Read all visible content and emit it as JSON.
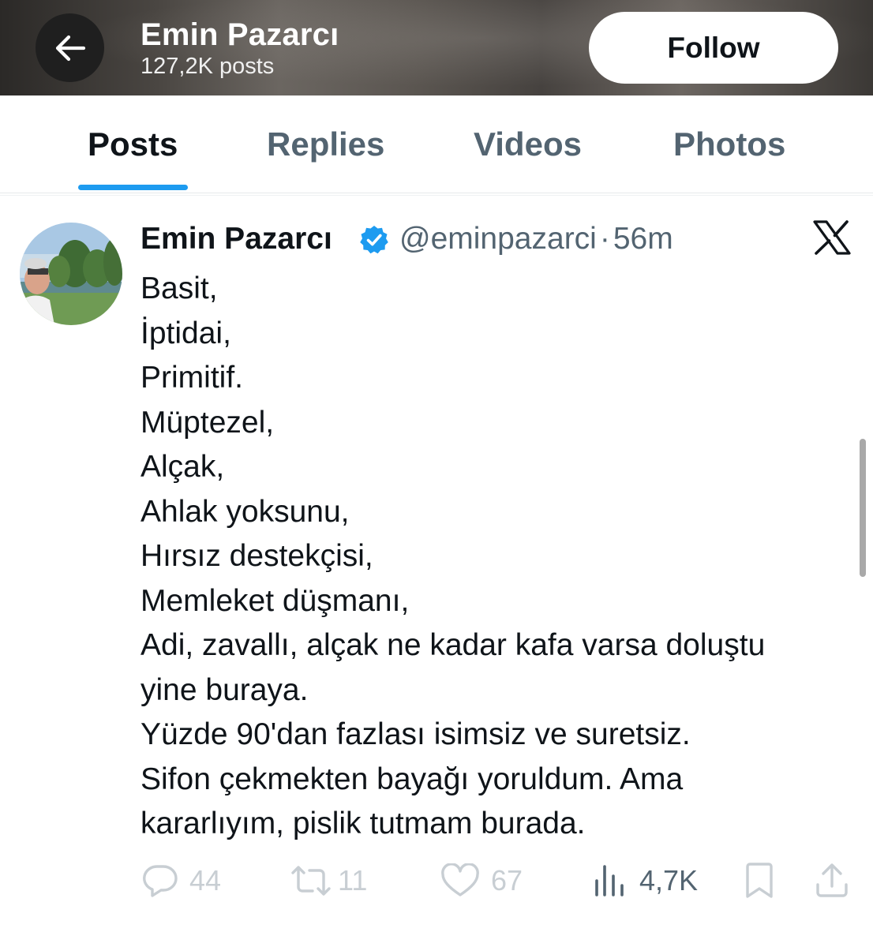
{
  "header": {
    "title": "Emin Pazarcı",
    "subtitle": "127,2K posts",
    "follow_label": "Follow"
  },
  "tabs": [
    {
      "label": "Posts",
      "active": true
    },
    {
      "label": "Replies",
      "active": false
    },
    {
      "label": "Videos",
      "active": false
    },
    {
      "label": "Photos",
      "active": false
    }
  ],
  "post": {
    "author_name": "Emin Pazarcı",
    "handle": "@eminpazarci",
    "separator": "·",
    "time": "56m",
    "verified": true,
    "lines": [
      "Basit,",
      "İptidai,",
      "Primitif.",
      "Müptezel,",
      "Alçak,",
      "Ahlak yoksunu,",
      "Hırsız destekçisi,",
      "Memleket düşmanı,",
      "Adi, zavallı, alçak ne kadar kafa varsa doluştu",
      "yine buraya.",
      "Yüzde 90'dan fazlası isimsiz ve suretsiz.",
      "Sifon çekmekten bayağı yoruldum. Ama",
      "kararlıyım, pislik tutmam burada."
    ],
    "stats": {
      "replies": "44",
      "reposts": "11",
      "likes": "67",
      "views": "4,7K"
    }
  },
  "icons": {
    "back": "arrow-left-icon",
    "verified": "verified-badge-icon",
    "platform": "x-logo-icon",
    "reply": "comment-icon",
    "repost": "repost-icon",
    "like": "heart-icon",
    "views": "views-chart-icon",
    "bookmark": "bookmark-icon",
    "share": "share-icon"
  },
  "colors": {
    "accent": "#1d9bf0",
    "text_primary": "#0f1419",
    "text_secondary": "#536471"
  }
}
